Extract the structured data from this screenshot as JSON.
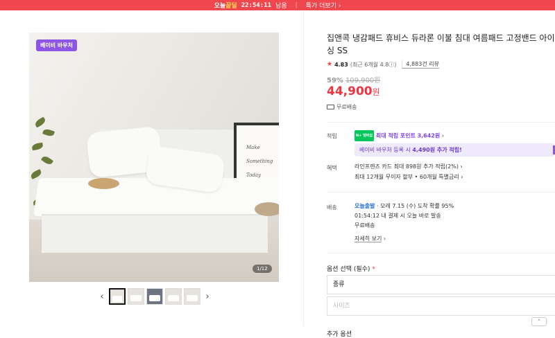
{
  "topbar": {
    "deal_part1": "오늘",
    "deal_part2": "끝딜",
    "countdown": "22:54:11",
    "remain": "남음",
    "more": "특가 더보기"
  },
  "gallery": {
    "badge": "베이비 바우처",
    "counter": "1/12",
    "thumbnail_count": 5,
    "frame_text": [
      "Make",
      "Something",
      "Today"
    ]
  },
  "product": {
    "title": "집앤콕 냉감패드 휴비스 듀라론 이불 침대 여름패드 고정밴드 아이싱 SS",
    "rating": "4.83",
    "rating_sub": "(최근 6개월 4.8ⓘ)",
    "reviews": "4,883건 리뷰",
    "discount_pct": "59%",
    "original_price": "109,900원",
    "price_num": "44,900",
    "price_unit": "원",
    "free_shipping": "무료배송"
  },
  "points": {
    "label": "적립",
    "npay_tag": "N+ 멤버십",
    "text": "최대 적립 포인트",
    "amount": "3,642원",
    "voucher_prefix": "베이비 바우처 등록 시",
    "voucher_amount": "4,490원 추가 적립!"
  },
  "benefit": {
    "label": "혜택",
    "line1": "라인프렌즈 카드 최대 898원 추가 적립(2%)",
    "line2": "최대 12개월 무이자 할부 • 60개월 특별금리"
  },
  "delivery": {
    "label": "배송",
    "type": "오늘출발",
    "line1_rest": "· 모레 7.15 (수) 도착 확률 95%",
    "line2": "01:54:12  내 결제 시 오늘 바로 발송",
    "line3": "무료배송",
    "detail_link": "자세히 보기"
  },
  "options": {
    "label": "옵션 선택 (필수)",
    "required_mark": "*",
    "select1": "종류",
    "select2": "사이즈",
    "next_label": "추가 옵션"
  }
}
